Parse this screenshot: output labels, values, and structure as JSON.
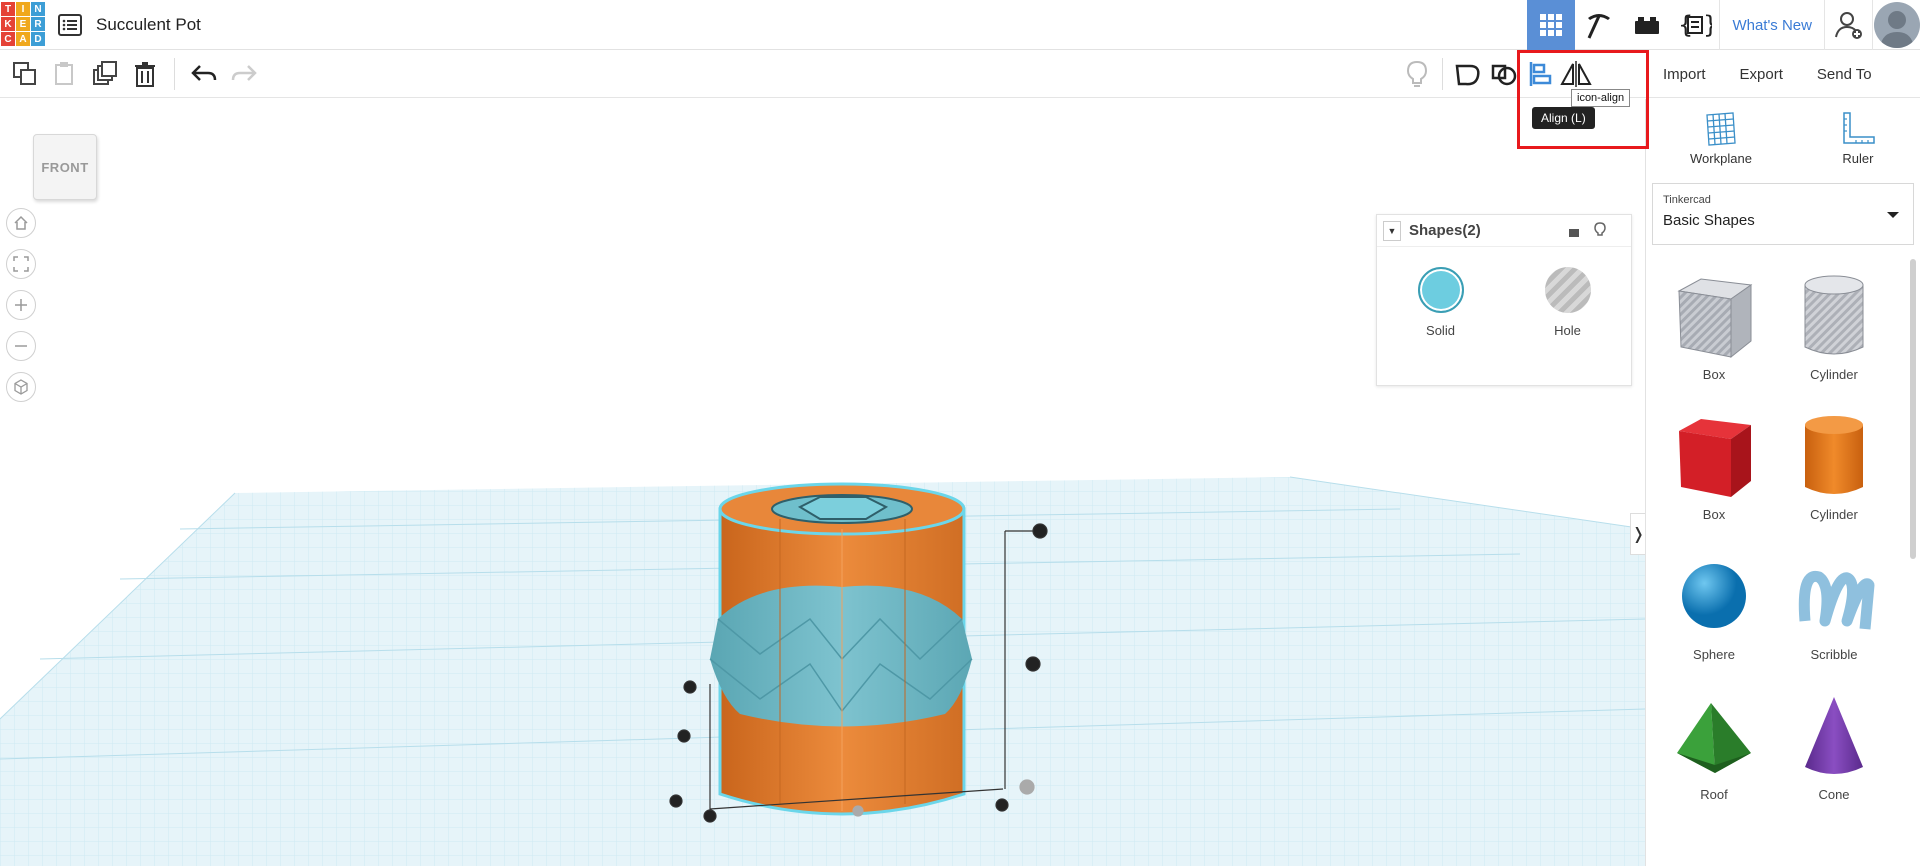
{
  "app": {
    "logo_letters": [
      "T",
      "I",
      "N",
      "K",
      "E",
      "R",
      "C",
      "A",
      "D"
    ],
    "logo_colors": [
      "#e54236",
      "#f0a81d",
      "#3d9ed6",
      "#e54236",
      "#f0a81d",
      "#3d9ed6",
      "#e54236",
      "#f0a81d",
      "#3d9ed6"
    ],
    "title": "Succulent Pot",
    "whats_new": "What's New"
  },
  "toolbar": {
    "import_label": "Import",
    "export_label": "Export",
    "send_to_label": "Send To",
    "tooltip_align": "Align (L)",
    "tooltip_icon_align": "icon-align"
  },
  "viewport": {
    "viewcube_label": "FRONT",
    "collapse_glyph": "❭"
  },
  "inspector": {
    "title": "Shapes(2)",
    "solid_label": "Solid",
    "hole_label": "Hole",
    "solid_color": "#6dcde0"
  },
  "library": {
    "workplane_label": "Workplane",
    "ruler_label": "Ruler",
    "source": "Tinkercad",
    "category": "Basic Shapes",
    "shapes": [
      {
        "label": "Box",
        "kind": "box-hole"
      },
      {
        "label": "Cylinder",
        "kind": "cyl-hole"
      },
      {
        "label": "Box",
        "kind": "box-red"
      },
      {
        "label": "Cylinder",
        "kind": "cyl-orange"
      },
      {
        "label": "Sphere",
        "kind": "sphere"
      },
      {
        "label": "Scribble",
        "kind": "scribble"
      },
      {
        "label": "Roof",
        "kind": "roof"
      },
      {
        "label": "Cone",
        "kind": "cone"
      }
    ]
  },
  "colors": {
    "accent": "#5a8fd6",
    "highlight": "#e8191d",
    "grid": "#bfe6f2",
    "orange": "#e8873a"
  }
}
